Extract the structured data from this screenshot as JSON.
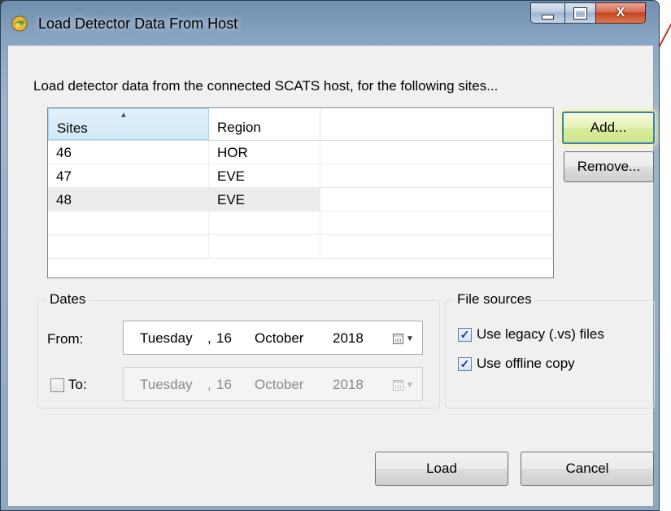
{
  "window": {
    "title": "Load Detector Data From Host",
    "minimize_glyph": "",
    "maximize_glyph": "",
    "close_glyph": "X"
  },
  "instruction": "Load detector data from the connected SCATS host, for the following sites...",
  "grid": {
    "columns": [
      "Sites",
      "Region",
      ""
    ],
    "rows": [
      {
        "site": "46",
        "region": "HOR"
      },
      {
        "site": "47",
        "region": "EVE"
      },
      {
        "site": "48",
        "region": "EVE"
      },
      {
        "site": "",
        "region": ""
      },
      {
        "site": "",
        "region": ""
      }
    ],
    "selected_row": 2
  },
  "buttons": {
    "add": "Add...",
    "remove": "Remove...",
    "load": "Load",
    "cancel": "Cancel"
  },
  "dates": {
    "title": "Dates",
    "from_label": "From:",
    "to_label": "To:",
    "to_checked": false,
    "from": {
      "weekday": "Tuesday",
      "sep": ",",
      "day": "16",
      "month": "October",
      "year": "2018"
    },
    "to": {
      "weekday": "Tuesday",
      "sep": ",",
      "day": "16",
      "month": "October",
      "year": "2018"
    }
  },
  "file_sources": {
    "title": "File sources",
    "legacy_label": "Use legacy (.vs) files",
    "legacy_checked": true,
    "offline_label": "Use offline copy",
    "offline_checked": true,
    "check_glyph": "✓"
  },
  "colors": {
    "add_highlight": "#f5f59a",
    "close_red": "#c5421f"
  }
}
